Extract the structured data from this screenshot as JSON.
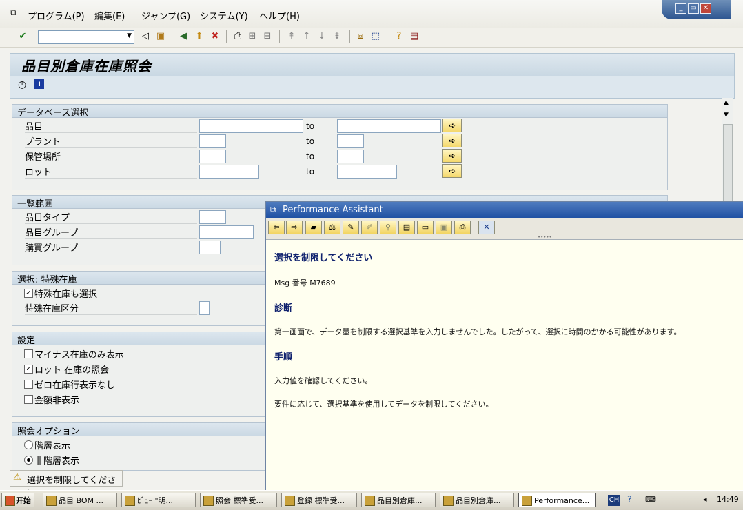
{
  "menubar": {
    "items": [
      "プログラム(P)",
      "編集(E)",
      "ジャンプ(G)",
      "システム(Y)",
      "ヘルプ(H)"
    ]
  },
  "window_controls": {
    "minimize": "_",
    "restore": "▭",
    "close": "✕"
  },
  "page_title": "品目別倉庫在庫照会",
  "groups": {
    "database": {
      "title": "データベース選択",
      "rows": [
        {
          "label": "品目",
          "to": "to"
        },
        {
          "label": "プラント",
          "to": "to"
        },
        {
          "label": "保管場所",
          "to": "to"
        },
        {
          "label": "ロット",
          "to": "to"
        }
      ]
    },
    "list_scope": {
      "title": "一覧範囲",
      "rows": [
        {
          "label": "品目タイプ"
        },
        {
          "label": "品目グループ"
        },
        {
          "label": "購買グループ"
        }
      ]
    },
    "special_stock": {
      "title": "選択: 特殊在庫",
      "checkbox_label": "特殊在庫も選択",
      "checkbox_checked": true,
      "field_label": "特殊在庫区分"
    },
    "settings": {
      "title": "設定",
      "options": [
        {
          "label": "マイナス在庫のみ表示",
          "checked": false
        },
        {
          "label": "ロット 在庫の照会",
          "checked": true
        },
        {
          "label": "ゼロ在庫行表示なし",
          "checked": false
        },
        {
          "label": "金額非表示",
          "checked": false
        }
      ]
    },
    "display_options": {
      "title": "照会オプション",
      "options": [
        {
          "label": "階層表示",
          "selected": false
        },
        {
          "label": "非階層表示",
          "selected": true
        }
      ]
    }
  },
  "status_bar": {
    "message": "選択を制限してください"
  },
  "performance_assistant": {
    "title": "Performance Assistant",
    "heading": "選択を制限してください",
    "msg_number": "Msg 番号  M7689",
    "diagnosis_heading": "診断",
    "diagnosis_text": "第一画面で、データ量を制限する選択基準を入力しませんでした。したがって、選択に時間のかかる可能性があります。",
    "procedure_heading": "手順",
    "procedure_text_1": "入力値を確認してください。",
    "procedure_text_2": "要件に応じて、選択基準を使用してデータを制限してください。"
  },
  "taskbar": {
    "start": "开始",
    "tasks": [
      "品目 BOM ...",
      "ﾋﾞｭｰ \"明...",
      "照会 標準受...",
      "登録 標準受...",
      "品目別倉庫...",
      "品目別倉庫...",
      "Performance..."
    ],
    "tray_text": "CH",
    "clock": "14:49"
  }
}
